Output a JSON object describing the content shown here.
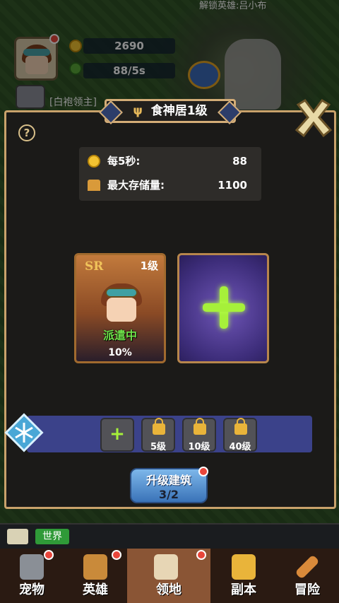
{
  "hud": {
    "gold": "2690",
    "income": "88/5s",
    "lord_tag": "[白袍领主]",
    "unlock_notice": "解锁英雄:吕小布"
  },
  "panel": {
    "title": "食神居1级",
    "help_icon": "?",
    "stats": [
      {
        "label": "每5秒:",
        "value": "88",
        "icon": "coin-icon"
      },
      {
        "label": "最大存储量:",
        "value": "1100",
        "icon": "storage-icon"
      }
    ],
    "hero_card": {
      "rarity": "SR",
      "level": "1级",
      "status": "派遣中",
      "percent": "10%"
    },
    "slots": [
      {
        "type": "add",
        "label": "+"
      },
      {
        "type": "locked",
        "label": "5级"
      },
      {
        "type": "locked",
        "label": "10级"
      },
      {
        "type": "locked",
        "label": "40级"
      }
    ],
    "upgrade": {
      "label": "升级建筑",
      "count": "3/2"
    }
  },
  "chat": {
    "channel": "世界"
  },
  "nav": [
    {
      "label": "宠物",
      "icon": "pet-icon",
      "dot": true,
      "active": false
    },
    {
      "label": "英雄",
      "icon": "hero-icon",
      "dot": true,
      "active": false
    },
    {
      "label": "领地",
      "icon": "castle-icon",
      "dot": true,
      "active": true
    },
    {
      "label": "副本",
      "icon": "dungeon-icon",
      "dot": false,
      "active": false
    },
    {
      "label": "冒险",
      "icon": "sword-icon",
      "dot": false,
      "active": false
    }
  ],
  "colors": {
    "accent_green": "#a6f03a",
    "panel_border": "#c9a26b",
    "dot_red": "#e8463b"
  }
}
